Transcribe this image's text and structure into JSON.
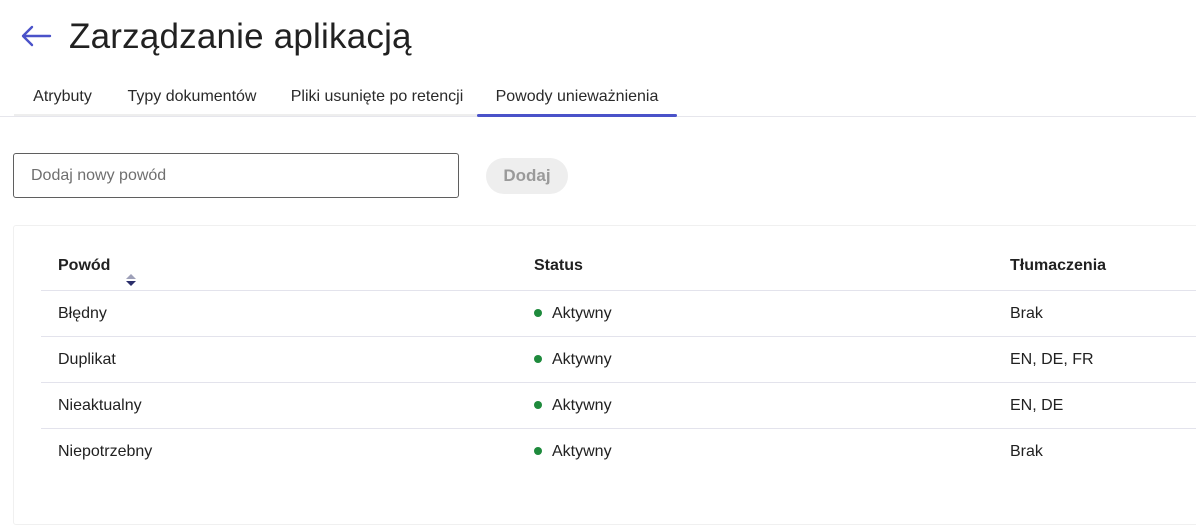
{
  "header": {
    "title": "Zarządzanie aplikacją",
    "back_icon": "arrow-left-icon",
    "accent_color": "#4a52c9"
  },
  "tabs": [
    {
      "label": "Atrybuty",
      "active": false
    },
    {
      "label": "Typy dokumentów",
      "active": false
    },
    {
      "label": "Pliki usunięte po retencji",
      "active": false
    },
    {
      "label": "Powody unieważnienia",
      "active": true
    }
  ],
  "form": {
    "input_placeholder": "Dodaj nowy powód",
    "input_value": "",
    "add_button_label": "Dodaj"
  },
  "table": {
    "columns": [
      "Powód",
      "Status",
      "Tłumaczenia"
    ],
    "sort_icon": "sort-icon",
    "status_color": "#1e8a3c",
    "rows": [
      {
        "reason": "Błędny",
        "status": "Aktywny",
        "translations": "Brak"
      },
      {
        "reason": "Duplikat",
        "status": "Aktywny",
        "translations": "EN, DE, FR"
      },
      {
        "reason": "Nieaktualny",
        "status": "Aktywny",
        "translations": "EN, DE"
      },
      {
        "reason": "Niepotrzebny",
        "status": "Aktywny",
        "translations": "Brak"
      }
    ]
  }
}
